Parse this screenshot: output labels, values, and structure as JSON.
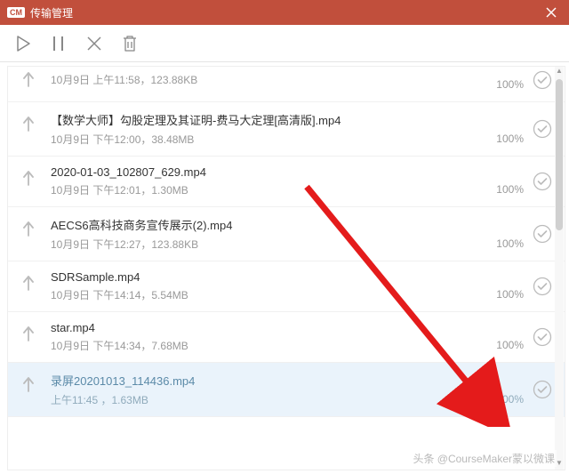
{
  "titlebar": {
    "logo": "CM",
    "title": "传输管理"
  },
  "items": [
    {
      "partial": true,
      "name": "",
      "meta": "10月9日 上午11:58，123.88KB",
      "progress": "100%"
    },
    {
      "name": "【数学大师】勾股定理及其证明-费马大定理[高清版].mp4",
      "meta": "10月9日 下午12:00，38.48MB",
      "progress": "100%"
    },
    {
      "name": "2020-01-03_102807_629.mp4",
      "meta": "10月9日 下午12:01，1.30MB",
      "progress": "100%"
    },
    {
      "name": "AECS6高科技商务宣传展示(2).mp4",
      "meta": "10月9日 下午12:27，123.88KB",
      "progress": "100%"
    },
    {
      "name": "SDRSample.mp4",
      "meta": "10月9日 下午14:14，5.54MB",
      "progress": "100%"
    },
    {
      "name": "star.mp4",
      "meta": "10月9日 下午14:34，7.68MB",
      "progress": "100%"
    },
    {
      "selected": true,
      "name": "录屏20201013_114436.mp4",
      "meta": "上午11:45 ，1.63MB",
      "progress": "100%"
    }
  ],
  "watermark": "头条 @CourseMaker蒙以微课"
}
